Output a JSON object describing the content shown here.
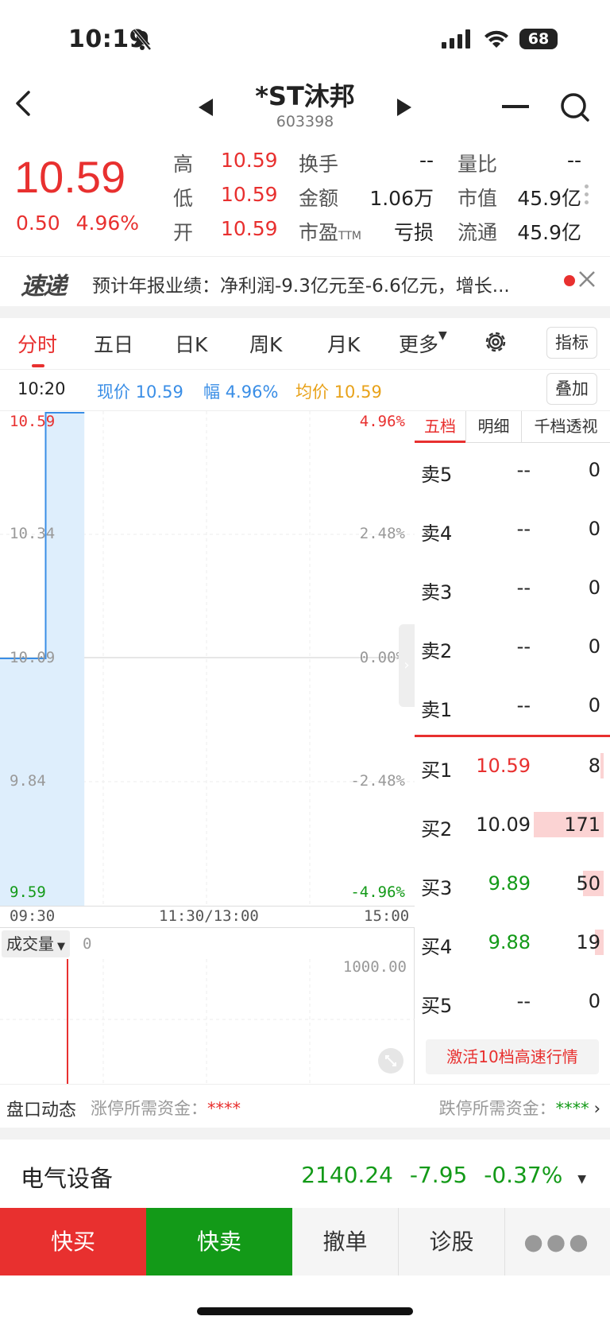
{
  "status_bar": {
    "time": "10:19",
    "battery": "68"
  },
  "nav": {
    "title": "*ST沐邦",
    "code": "603398"
  },
  "quote": {
    "price": "10.59",
    "change": "0.50",
    "change_pct": "4.96%",
    "stats": [
      {
        "label": "高",
        "value": "10.59"
      },
      {
        "label": "低",
        "value": "10.59"
      },
      {
        "label": "开",
        "value": "10.59"
      },
      {
        "label": "换手",
        "value": "--"
      },
      {
        "label": "金额",
        "value": "1.06万"
      },
      {
        "label": "市盈",
        "label_sub": "TTM",
        "value": "亏损"
      },
      {
        "label": "量比",
        "value": "--"
      },
      {
        "label": "市值",
        "value": "45.9亿"
      },
      {
        "label": "流通",
        "value": "45.9亿"
      }
    ]
  },
  "news": {
    "logo": "速递",
    "text": "预计年报业绩：净利润-9.3亿元至-6.6亿元，增长..."
  },
  "tabs": [
    "分时",
    "五日",
    "日K",
    "周K",
    "月K",
    "更多"
  ],
  "tab_active": 0,
  "indicator_btn": "指标",
  "overlay_btn": "叠加",
  "info_row": {
    "time": "10:20",
    "price_label": "现价",
    "price": "10.59",
    "pct_label": "幅",
    "pct": "4.96%",
    "avg_label": "均价",
    "avg": "10.59"
  },
  "chart": {
    "y_left": [
      "10.59",
      "10.34",
      "10.09",
      "9.84",
      "9.59"
    ],
    "y_right": [
      "4.96%",
      "2.48%",
      "0.00%",
      "-2.48%",
      "-4.96%"
    ],
    "x_labels": [
      "09:30",
      "11:30/13:00",
      "15:00"
    ],
    "volume_label": "成交量",
    "volume_value": "0",
    "volume_max": "1000.00"
  },
  "chart_data": {
    "type": "line",
    "title": "",
    "x": [
      "09:30",
      "09:31",
      "09:32",
      "09:33"
    ],
    "series": [
      {
        "values": [
          10.09,
          10.09,
          10.59,
          10.59
        ]
      }
    ],
    "ylim": [
      9.59,
      10.59
    ],
    "xlabel": "",
    "ylabel": ""
  },
  "orderbook": {
    "tabs": [
      "五档",
      "明细",
      "千档透视"
    ],
    "asks": [
      {
        "label": "卖5",
        "price": "--",
        "vol": "0"
      },
      {
        "label": "卖4",
        "price": "--",
        "vol": "0"
      },
      {
        "label": "卖3",
        "price": "--",
        "vol": "0"
      },
      {
        "label": "卖2",
        "price": "--",
        "vol": "0"
      },
      {
        "label": "卖1",
        "price": "--",
        "vol": "0"
      }
    ],
    "bids": [
      {
        "label": "买1",
        "price": "10.59",
        "vol": "8",
        "color": "red",
        "fill": 0.05
      },
      {
        "label": "买2",
        "price": "10.09",
        "vol": "171",
        "color": "black",
        "fill": 1.0
      },
      {
        "label": "买3",
        "price": "9.89",
        "vol": "50",
        "color": "green",
        "fill": 0.3
      },
      {
        "label": "买4",
        "price": "9.88",
        "vol": "19",
        "color": "green",
        "fill": 0.12
      },
      {
        "label": "买5",
        "price": "--",
        "vol": "0",
        "color": "black",
        "fill": 0
      }
    ],
    "activate": "激活10档高速行情"
  },
  "pankou": {
    "title": "盘口动态",
    "limit_up_label": "涨停所需资金：",
    "limit_up_value": "****",
    "limit_down_label": "跌停所需资金：",
    "limit_down_value": "****"
  },
  "sector": {
    "name": "电气设备",
    "value": "2140.24",
    "change": "-7.95",
    "pct": "-0.37%"
  },
  "bottom_bar": {
    "buy": "快买",
    "sell": "快卖",
    "cancel": "撤单",
    "diagnose": "诊股"
  },
  "colors": {
    "red": "#e8302f",
    "green": "#139a18",
    "fill": "#deeefc",
    "line": "#3a8ee6"
  }
}
